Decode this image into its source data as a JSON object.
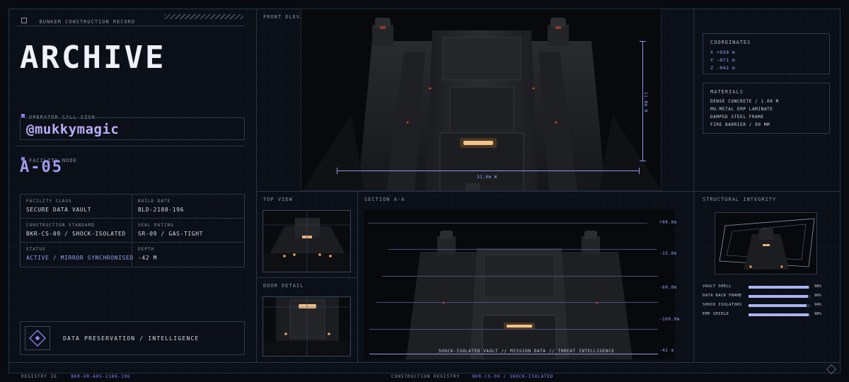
{
  "header": {
    "record_label": "BUNKER CONSTRUCTION RECORD",
    "title": "ARCHIVE"
  },
  "operator": {
    "label": "OPERATOR CALL SIGN",
    "value": "@mukkymagic"
  },
  "facility_node": {
    "label": "FACILITY NODE",
    "value": "A-05"
  },
  "details": {
    "facility_class_label": "FACILITY CLASS",
    "facility_class": "SECURE DATA VAULT",
    "build_date_label": "BUILD DATE",
    "build_date": "BLD-2188-196",
    "construction_standard_label": "CONSTRUCTION STANDARD",
    "construction_standard": "BKR-CS-09 / SHOCK-ISOLATED",
    "seal_rating_label": "SEAL RATING",
    "seal_rating": "SR-09 / GAS-TIGHT",
    "status_label": "STATUS",
    "status": "ACTIVE / MIRROR SYNCHRONISED",
    "depth_label": "DEPTH",
    "depth": "-42 m"
  },
  "purpose": {
    "label": "DATA PRESERVATION / INTELLIGENCE"
  },
  "front_elevation": {
    "label": "FRONT ELEVATION",
    "height_dim": "11.0m H",
    "width_dim": "31.0m W"
  },
  "top_view": {
    "label": "TOP VIEW"
  },
  "door_detail": {
    "label": "DOOR DETAIL"
  },
  "section": {
    "label": "SECTION A-A",
    "levels": [
      "+00.0m",
      "-15.0m",
      "-60.0m",
      "-109.0m",
      "-42 m"
    ],
    "caption": "SHOCK-ISOLATED VAULT // MISSION DATA // THREAT INTELLIGENCE"
  },
  "coordinates": {
    "label": "COORDINATES",
    "x": "X +038 m",
    "y": "Y -071 m",
    "z": "Z -042 m"
  },
  "materials": {
    "label": "MATERIALS",
    "items": [
      "DENSE CONCRETE / 1.00 M",
      "MU-METAL EMP LAMINATE",
      "DAMPED STEEL FRAME",
      "FIRE BARRIER / 90 MM"
    ]
  },
  "integrity": {
    "label": "STRUCTURAL INTEGRITY",
    "rows": [
      {
        "name": "VAULT SHELL",
        "value": "98%",
        "fraction": 0.98
      },
      {
        "name": "DATA RACK FRAME",
        "value": "96%",
        "fraction": 0.96
      },
      {
        "name": "SHOCK ISOLATORS",
        "value": "94%",
        "fraction": 0.94
      },
      {
        "name": "EMP SHIELD",
        "value": "98%",
        "fraction": 0.98
      }
    ]
  },
  "footer": {
    "registry_id_label": "REGISTRY ID",
    "registry_id": "BKR-OR-A05-2188-196",
    "construction_registry_label": "CONSTRUCTION REGISTRY",
    "construction_registry": "BKR-CS-09 / SHOCK-ISOLATED"
  },
  "colors": {
    "accent": "#8c86ee",
    "bar": "#a9b4f0",
    "background": "#0b0f17"
  }
}
